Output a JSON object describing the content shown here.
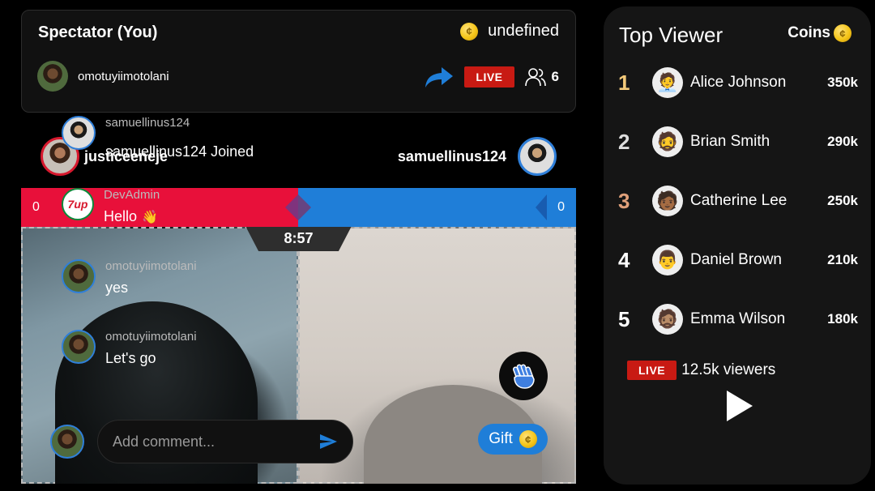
{
  "header": {
    "title": "Spectator (You)",
    "coins_value": "undefined",
    "host_username": "omotuyiimotolani",
    "live_label": "LIVE",
    "viewer_count": "6"
  },
  "join_row": {
    "left_name": "justiceeneje",
    "joined_message": "samuellinus124 Joined",
    "right_name": "samuellinus124"
  },
  "battle": {
    "left_score": "0",
    "right_score": "0",
    "timer": "8:57"
  },
  "chat": [
    {
      "username": "samuellinus124",
      "text": ""
    },
    {
      "username": "DevAdmin",
      "text": "Hello",
      "emoji": "👋"
    },
    {
      "username": "omotuyiimotolani",
      "text": "yes"
    },
    {
      "username": "omotuyiimotolani",
      "text": "Let's go"
    }
  ],
  "comment": {
    "placeholder": "Add comment..."
  },
  "gift": {
    "label": "Gift"
  },
  "top_viewer": {
    "title": "Top Viewer",
    "coins_label": "Coins",
    "entries": [
      {
        "rank": "1",
        "name": "Alice Johnson",
        "coins": "350k",
        "rank_color": "#f3c97a",
        "emoji": "🧑‍💼"
      },
      {
        "rank": "2",
        "name": "Brian Smith",
        "coins": "290k",
        "rank_color": "#dddddd",
        "emoji": "🧔"
      },
      {
        "rank": "3",
        "name": "Catherine Lee",
        "coins": "250k",
        "rank_color": "#e0a07a",
        "emoji": "🧑🏾"
      },
      {
        "rank": "4",
        "name": "Daniel Brown",
        "coins": "210k",
        "rank_color": "#ffffff",
        "emoji": "👨"
      },
      {
        "rank": "5",
        "name": "Emma Wilson",
        "coins": "180k",
        "rank_color": "#ffffff",
        "emoji": "🧔🏽"
      }
    ],
    "live_label": "LIVE",
    "live_viewers": "12.5k viewers"
  },
  "colors": {
    "live_red": "#c81a13",
    "team_red": "#e8103a",
    "team_blue": "#1f7ed8",
    "coin_gold": "#f5c518"
  },
  "icons": [
    "coin-icon",
    "share-icon",
    "users-icon",
    "send-icon",
    "clap-icon",
    "play-icon"
  ]
}
